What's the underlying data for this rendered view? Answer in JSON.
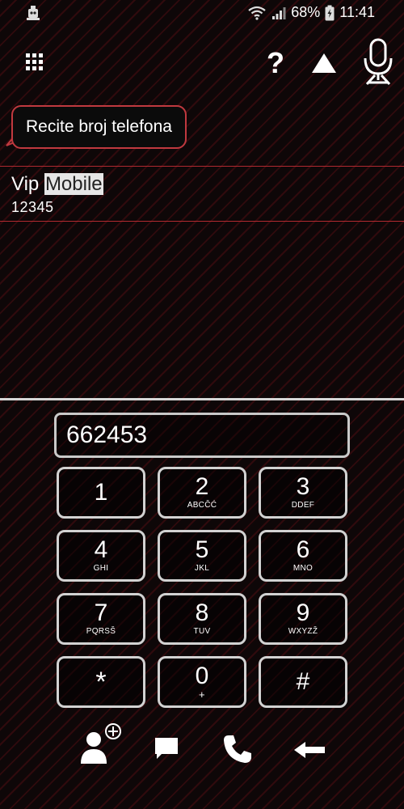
{
  "status_bar": {
    "battery_percent": "68%",
    "time": "11:41"
  },
  "toolbar": {
    "help_label": "?"
  },
  "prompt": {
    "text": "Recite broj telefona"
  },
  "contact": {
    "name_part1": "Vip",
    "name_part2": "Mobile",
    "number": "12345"
  },
  "dialer": {
    "display_value": "662453",
    "keys": [
      {
        "digit": "1",
        "letters": ""
      },
      {
        "digit": "2",
        "letters": "ABCČĆ"
      },
      {
        "digit": "3",
        "letters": "DDEF"
      },
      {
        "digit": "4",
        "letters": "GHI"
      },
      {
        "digit": "5",
        "letters": "JKL"
      },
      {
        "digit": "6",
        "letters": "MNO"
      },
      {
        "digit": "7",
        "letters": "PQRSŠ"
      },
      {
        "digit": "8",
        "letters": "TUV"
      },
      {
        "digit": "9",
        "letters": "WXYZŽ"
      },
      {
        "digit": "*",
        "letters": ""
      },
      {
        "digit": "0",
        "letters": "+"
      },
      {
        "digit": "#",
        "letters": ""
      }
    ]
  },
  "bottom_bar": {
    "icons": [
      "add-contact-icon",
      "message-icon",
      "phone-icon",
      "backspace-icon"
    ]
  },
  "colors": {
    "accent_red": "#c0393f",
    "background": "#0e0708",
    "key_border": "#d2d2d2"
  }
}
